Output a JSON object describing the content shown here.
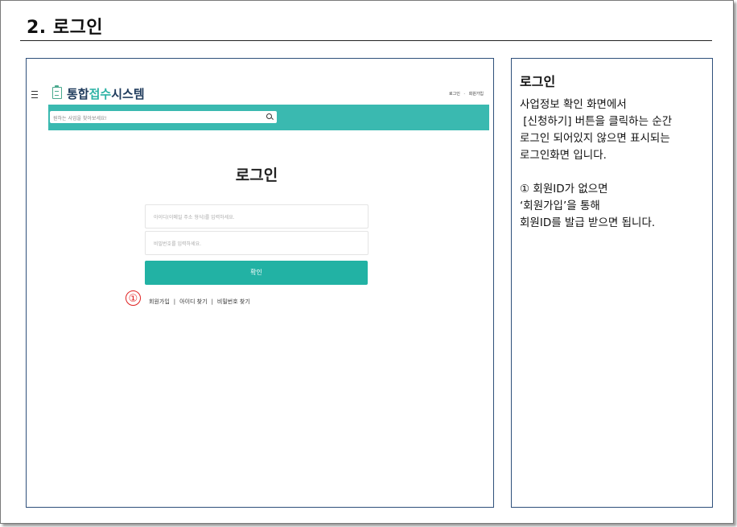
{
  "section": {
    "title": "2. 로그인"
  },
  "mockup": {
    "logo": {
      "part1": "통합",
      "part2": "접수",
      "part3": "시스템"
    },
    "top_links": {
      "login": "로그인",
      "divider": "·",
      "signup": "회원가입"
    },
    "search": {
      "placeholder": "원하는 사업을 찾아보세요!"
    },
    "heading": "로그인",
    "id_field": {
      "placeholder": "아이디(이메일 주소 형식)를 입력하세요."
    },
    "password_field": {
      "placeholder": "비밀번호를 입력하세요."
    },
    "confirm_label": "확인",
    "marker": "①",
    "links": {
      "signup": "회원가입",
      "sep": "|",
      "find_id": "아이디 찾기",
      "find_password": "비밀번호 찾기"
    }
  },
  "description": {
    "title": "로그인",
    "lines1": [
      "사업정보 확인 화면에서",
      " [신청하기] 버튼을 클릭하는 순간",
      "로그인 되어있지 않으면 표시되는",
      "로그인화면 입니다."
    ],
    "lines2": [
      "① 회원ID가 없으면",
      "‘회원가입’을 통해",
      "회원ID를 발급 받으면 됩니다."
    ]
  },
  "colors": {
    "teal": "#3ab9b0",
    "button": "#22b2a4",
    "marker": "#e02020",
    "border": "#2e4f7a"
  }
}
